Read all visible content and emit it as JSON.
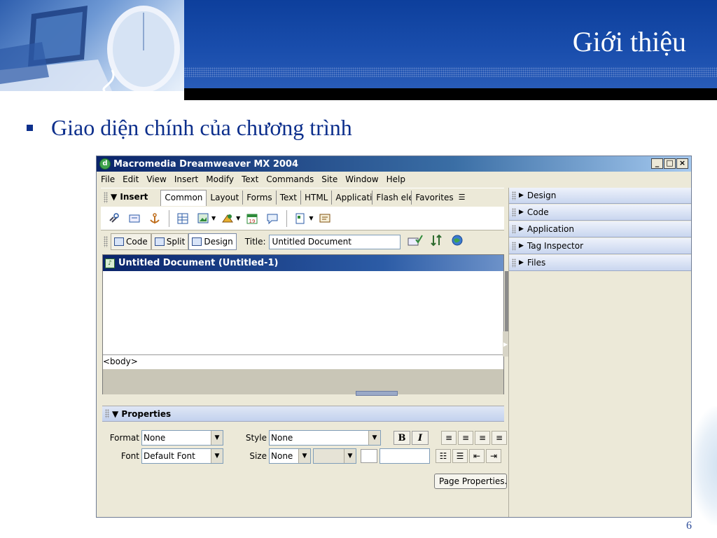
{
  "slide": {
    "title": "Giới thiệu",
    "bullet": "Giao diện chính của chương trình",
    "page_number": "6"
  },
  "window": {
    "title": "Macromedia Dreamweaver MX 2004",
    "controls": {
      "minimize": "_",
      "maximize": "□",
      "close": "×"
    }
  },
  "menu": [
    "File",
    "Edit",
    "View",
    "Insert",
    "Modify",
    "Text",
    "Commands",
    "Site",
    "Window",
    "Help"
  ],
  "insert_bar": {
    "label": "▼ Insert",
    "tabs": [
      "Common",
      "Layout",
      "Forms",
      "Text",
      "HTML",
      "Applicati",
      "Flash ele",
      "Favorites"
    ],
    "active_tab": "Common",
    "menu_icon": "☰"
  },
  "doc_toolbar": {
    "code_label": "Code",
    "split_label": "Split",
    "design_label": "Design",
    "title_label": "Title:",
    "title_value": "Untitled Document"
  },
  "document": {
    "window_title": "Untitled Document (Untitled-1)",
    "tag_selector": "<body>"
  },
  "properties": {
    "header": "▼ Properties",
    "format_label": "Format",
    "format_value": "None",
    "style_label": "Style",
    "style_value": "None",
    "font_label": "Font",
    "font_value": "Default Font",
    "size_label": "Size",
    "size_value": "None",
    "bold": "B",
    "italic": "I",
    "page_properties": "Page Properties..."
  },
  "side_panels": [
    "Design",
    "Code",
    "Application",
    "Tag Inspector",
    "Files"
  ],
  "colors": {
    "slide_blue": "#0d2f8c",
    "title_bar_start": "#0a246a",
    "chrome": "#ece9d8"
  }
}
